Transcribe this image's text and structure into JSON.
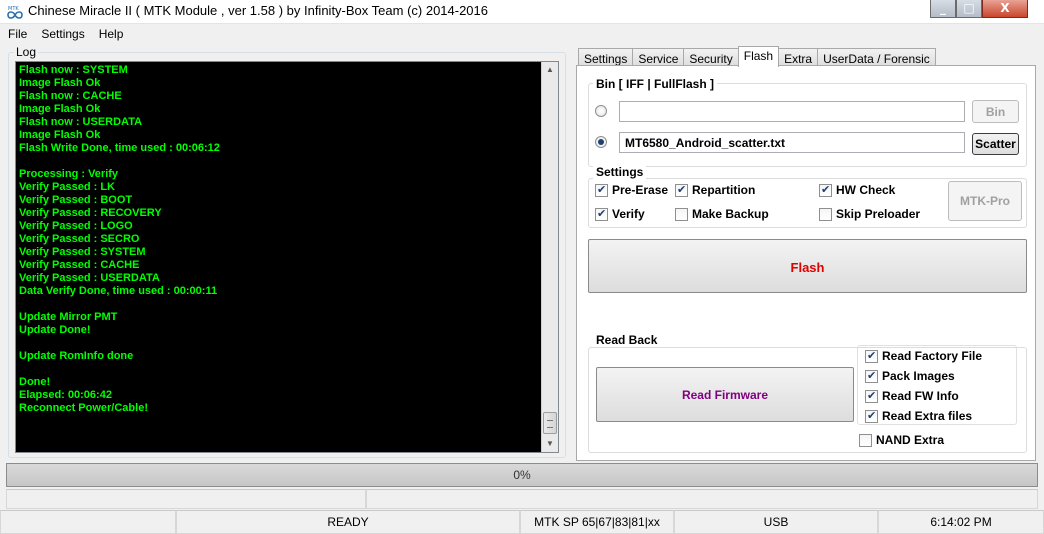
{
  "window": {
    "title": "Chinese Miracle II ( MTK Module , ver 1.58 ) by Infinity-Box Team (c) 2014-2016",
    "minimize_glyph": "_",
    "maximize_glyph": "□",
    "close_glyph": "X"
  },
  "menu": [
    "File",
    "Settings",
    "Help"
  ],
  "log": {
    "label": "Log",
    "lines": [
      "Flash now : SYSTEM",
      "Image Flash Ok",
      "Flash now : CACHE",
      "Image Flash Ok",
      "Flash now : USERDATA",
      "Image Flash Ok",
      "Flash Write Done, time used : 00:06:12",
      "",
      "Processing : Verify",
      "Verify Passed : LK",
      "Verify Passed : BOOT",
      "Verify Passed : RECOVERY",
      "Verify Passed : LOGO",
      "Verify Passed : SECRO",
      "Verify Passed : SYSTEM",
      "Verify Passed : CACHE",
      "Verify Passed : USERDATA",
      "Data Verify Done, time used : 00:00:11",
      "",
      "Update Mirror PMT",
      "Update Done!",
      "",
      "Update RomInfo done",
      "",
      "Done!",
      "Elapsed: 00:06:42",
      "Reconnect Power/Cable!"
    ],
    "text_color": "#00ff00"
  },
  "tabs": [
    "Settings",
    "Service",
    "Security",
    "Flash",
    "Extra",
    "UserData / Forensic"
  ],
  "active_tab": "Flash",
  "bin": {
    "title": "Bin  [ IFF | FullFlash ]",
    "file_value": "",
    "bin_button": "Bin",
    "scatter_value": "MT6580_Android_scatter.txt",
    "scatter_button": "Scatter",
    "selected": "scatter"
  },
  "settings": {
    "title": "Settings",
    "pre_erase": {
      "label": "Pre-Erase",
      "checked": true
    },
    "repartition": {
      "label": "Repartition",
      "checked": true
    },
    "hw_check": {
      "label": "HW Check",
      "checked": true
    },
    "verify": {
      "label": "Verify",
      "checked": true
    },
    "make_backup": {
      "label": "Make Backup",
      "checked": false
    },
    "skip_preloader": {
      "label": "Skip Preloader",
      "checked": false
    },
    "mtk_pro_button": "MTK-Pro"
  },
  "flash_button": {
    "label": "Flash",
    "color": "#e00000"
  },
  "read_back": {
    "title": "Read Back",
    "read_firmware_button": {
      "label": "Read Firmware",
      "color": "#800080"
    },
    "read_factory_file": {
      "label": "Read Factory File",
      "checked": true
    },
    "pack_images": {
      "label": "Pack Images",
      "checked": true
    },
    "read_fw_info": {
      "label": "Read FW Info",
      "checked": true
    },
    "read_extra_files": {
      "label": "Read Extra files",
      "checked": true
    },
    "nand_extra": {
      "label": "NAND Extra",
      "checked": false
    }
  },
  "progress": {
    "text": "0%",
    "value": 0
  },
  "status": {
    "state": "READY",
    "model": "MTK SP 65|67|83|81|xx",
    "port": "USB",
    "time": "6:14:02 PM"
  }
}
